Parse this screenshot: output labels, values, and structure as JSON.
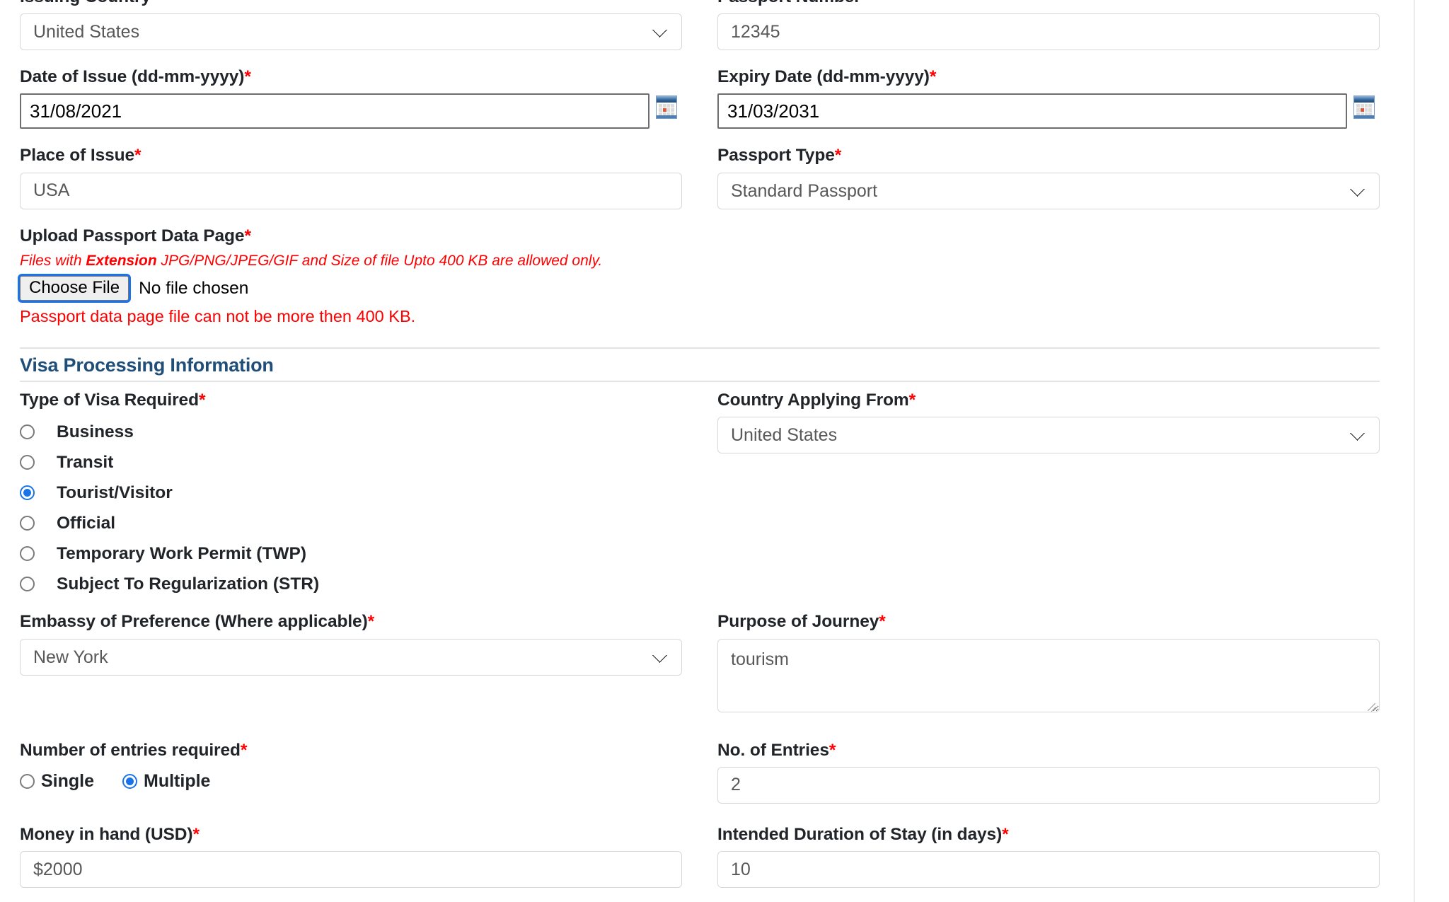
{
  "passport_section": {
    "issuing_country": {
      "label": "Issuing Country",
      "required": "*",
      "value": "United States",
      "options": [
        "United States"
      ]
    },
    "passport_number": {
      "label": "Passport Number",
      "required": "*",
      "value": "12345"
    },
    "date_of_issue": {
      "label": "Date of Issue (dd-mm-yyyy)",
      "required": "*",
      "value": "31/08/2021",
      "icon": "calendar-icon"
    },
    "expiry_date": {
      "label": "Expiry Date (dd-mm-yyyy)",
      "required": "*",
      "value": "31/03/2031",
      "icon": "calendar-icon"
    },
    "place_of_issue": {
      "label": "Place of Issue",
      "required": "*",
      "value": "USA"
    },
    "passport_type": {
      "label": "Passport Type",
      "required": "*",
      "value": "Standard Passport",
      "options": [
        "Standard Passport"
      ]
    },
    "upload": {
      "label": "Upload Passport Data Page",
      "required": "*",
      "hint_prefix": "Files with ",
      "hint_bold": "Extension",
      "hint_suffix": " JPG/PNG/JPEG/GIF and Size of file Upto 400 KB are allowed only.",
      "choose_file_label": "Choose File",
      "file_status": "No file chosen",
      "error": "Passport data page file can not be more then 400 KB."
    }
  },
  "visa_section": {
    "title": "Visa Processing Information",
    "visa_type": {
      "label": "Type of Visa Required",
      "required": "*",
      "selected": "Tourist/Visitor",
      "options": [
        {
          "label": "Business",
          "selected": false
        },
        {
          "label": "Transit",
          "selected": false
        },
        {
          "label": "Tourist/Visitor",
          "selected": true
        },
        {
          "label": "Official",
          "selected": false
        },
        {
          "label": "Temporary Work Permit (TWP)",
          "selected": false
        },
        {
          "label": "Subject To Regularization (STR)",
          "selected": false
        }
      ]
    },
    "country_applying_from": {
      "label": "Country Applying From",
      "required": "*",
      "value": "United States",
      "options": [
        "United States"
      ]
    },
    "embassy": {
      "label": "Embassy of Preference (Where applicable)",
      "required": "*",
      "value": "New York",
      "options": [
        "New York"
      ]
    },
    "purpose_of_journey": {
      "label": "Purpose of Journey",
      "required": "*",
      "value": "tourism"
    },
    "entries_required": {
      "label": "Number of entries required",
      "required": "*",
      "selected": "Multiple",
      "options": [
        {
          "label": "Single",
          "selected": false
        },
        {
          "label": "Multiple",
          "selected": true
        }
      ]
    },
    "no_of_entries": {
      "label": "No. of Entries",
      "required": "*",
      "value": "2"
    },
    "money_in_hand": {
      "label": "Money in hand (USD)",
      "required": "*",
      "value": "$2000"
    },
    "duration_of_stay": {
      "label": "Intended Duration of Stay (in days)",
      "required": "*",
      "value": "10"
    }
  },
  "colors": {
    "required_star": "#ff0000",
    "section_heading": "#1f4e79",
    "error_text": "#ff0000",
    "radio_selected": "#1a73e8",
    "focus_ring": "#1a73e8"
  }
}
